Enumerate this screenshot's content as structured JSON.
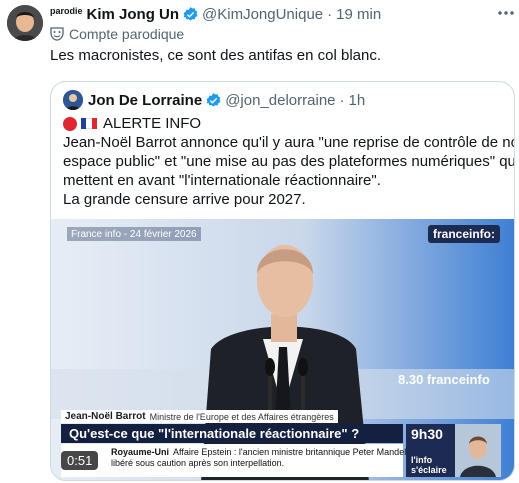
{
  "post": {
    "parody_tag": "parodie",
    "author_name": "Kim Jong Un",
    "author_handle": "@KimJongUnique",
    "separator": "·",
    "time": "19 min",
    "parody_label": "Compte parodique",
    "text": "Les macronistes, ce sont des antifas en col blanc."
  },
  "quote": {
    "author_name": "Jon De Lorraine",
    "author_handle": "@jon_delorraine",
    "separator": "·",
    "time": "1h",
    "alert": "ALERTE INFO",
    "lines": [
      "Jean-Noël Barrot annonce qu'il y aura \"une reprise de contrôle de notre",
      "espace public\" et \"une mise au pas des plateformes numériques\" qui",
      "mettent en avant \"l'internationale réactionnaire\".",
      "La grande censure arrive pour 2027."
    ]
  },
  "video": {
    "date_tag": "France info - 24 février 2026",
    "channel_logo": "franceinfo:",
    "time_overlay": "8.30 franceinfo",
    "caption_name": "Jean-Noël Barrot",
    "caption_role": "Ministre de l'Europe et des Affaires étrangères",
    "question": "Qu'est-ce que \"l'internationale réactionnaire\" ?",
    "ticker_lines": [
      {
        "bold": "Royaume-Uni",
        "text": "Affaire Epstein : l'ancien ministre britannique Peter Mandelson"
      },
      {
        "bold": "",
        "text": "libéré sous caution après son interpellation."
      }
    ],
    "badge_time": "9h30",
    "badge_sub": "l'info s'éclaire",
    "duration": "0:51"
  },
  "colors": {
    "verified_blue": "#1d9bf0",
    "text_primary": "#0f1419",
    "text_secondary": "#536471",
    "franceinfo_navy": "#13203f"
  },
  "icons": {
    "verified": "verified-badge-icon",
    "more": "more-horizontal-icon",
    "parody": "theater-mask-icon"
  }
}
